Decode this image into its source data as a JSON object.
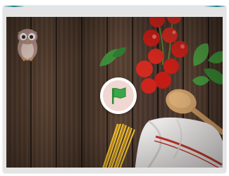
{
  "app": {
    "accent_color": "#1e7c88",
    "frame_color": "#e4e4e4"
  },
  "stage": {
    "background": "rustic-wood-table-with-pasta-ingredients"
  },
  "controls": {
    "start_button": {
      "icon": "green-flag-icon",
      "color": "#3aa64a"
    }
  },
  "sprites": [
    "owl-icon",
    "cherry-tomatoes",
    "basil-leaves",
    "wooden-spoon",
    "spaghetti",
    "kitchen-towel"
  ]
}
